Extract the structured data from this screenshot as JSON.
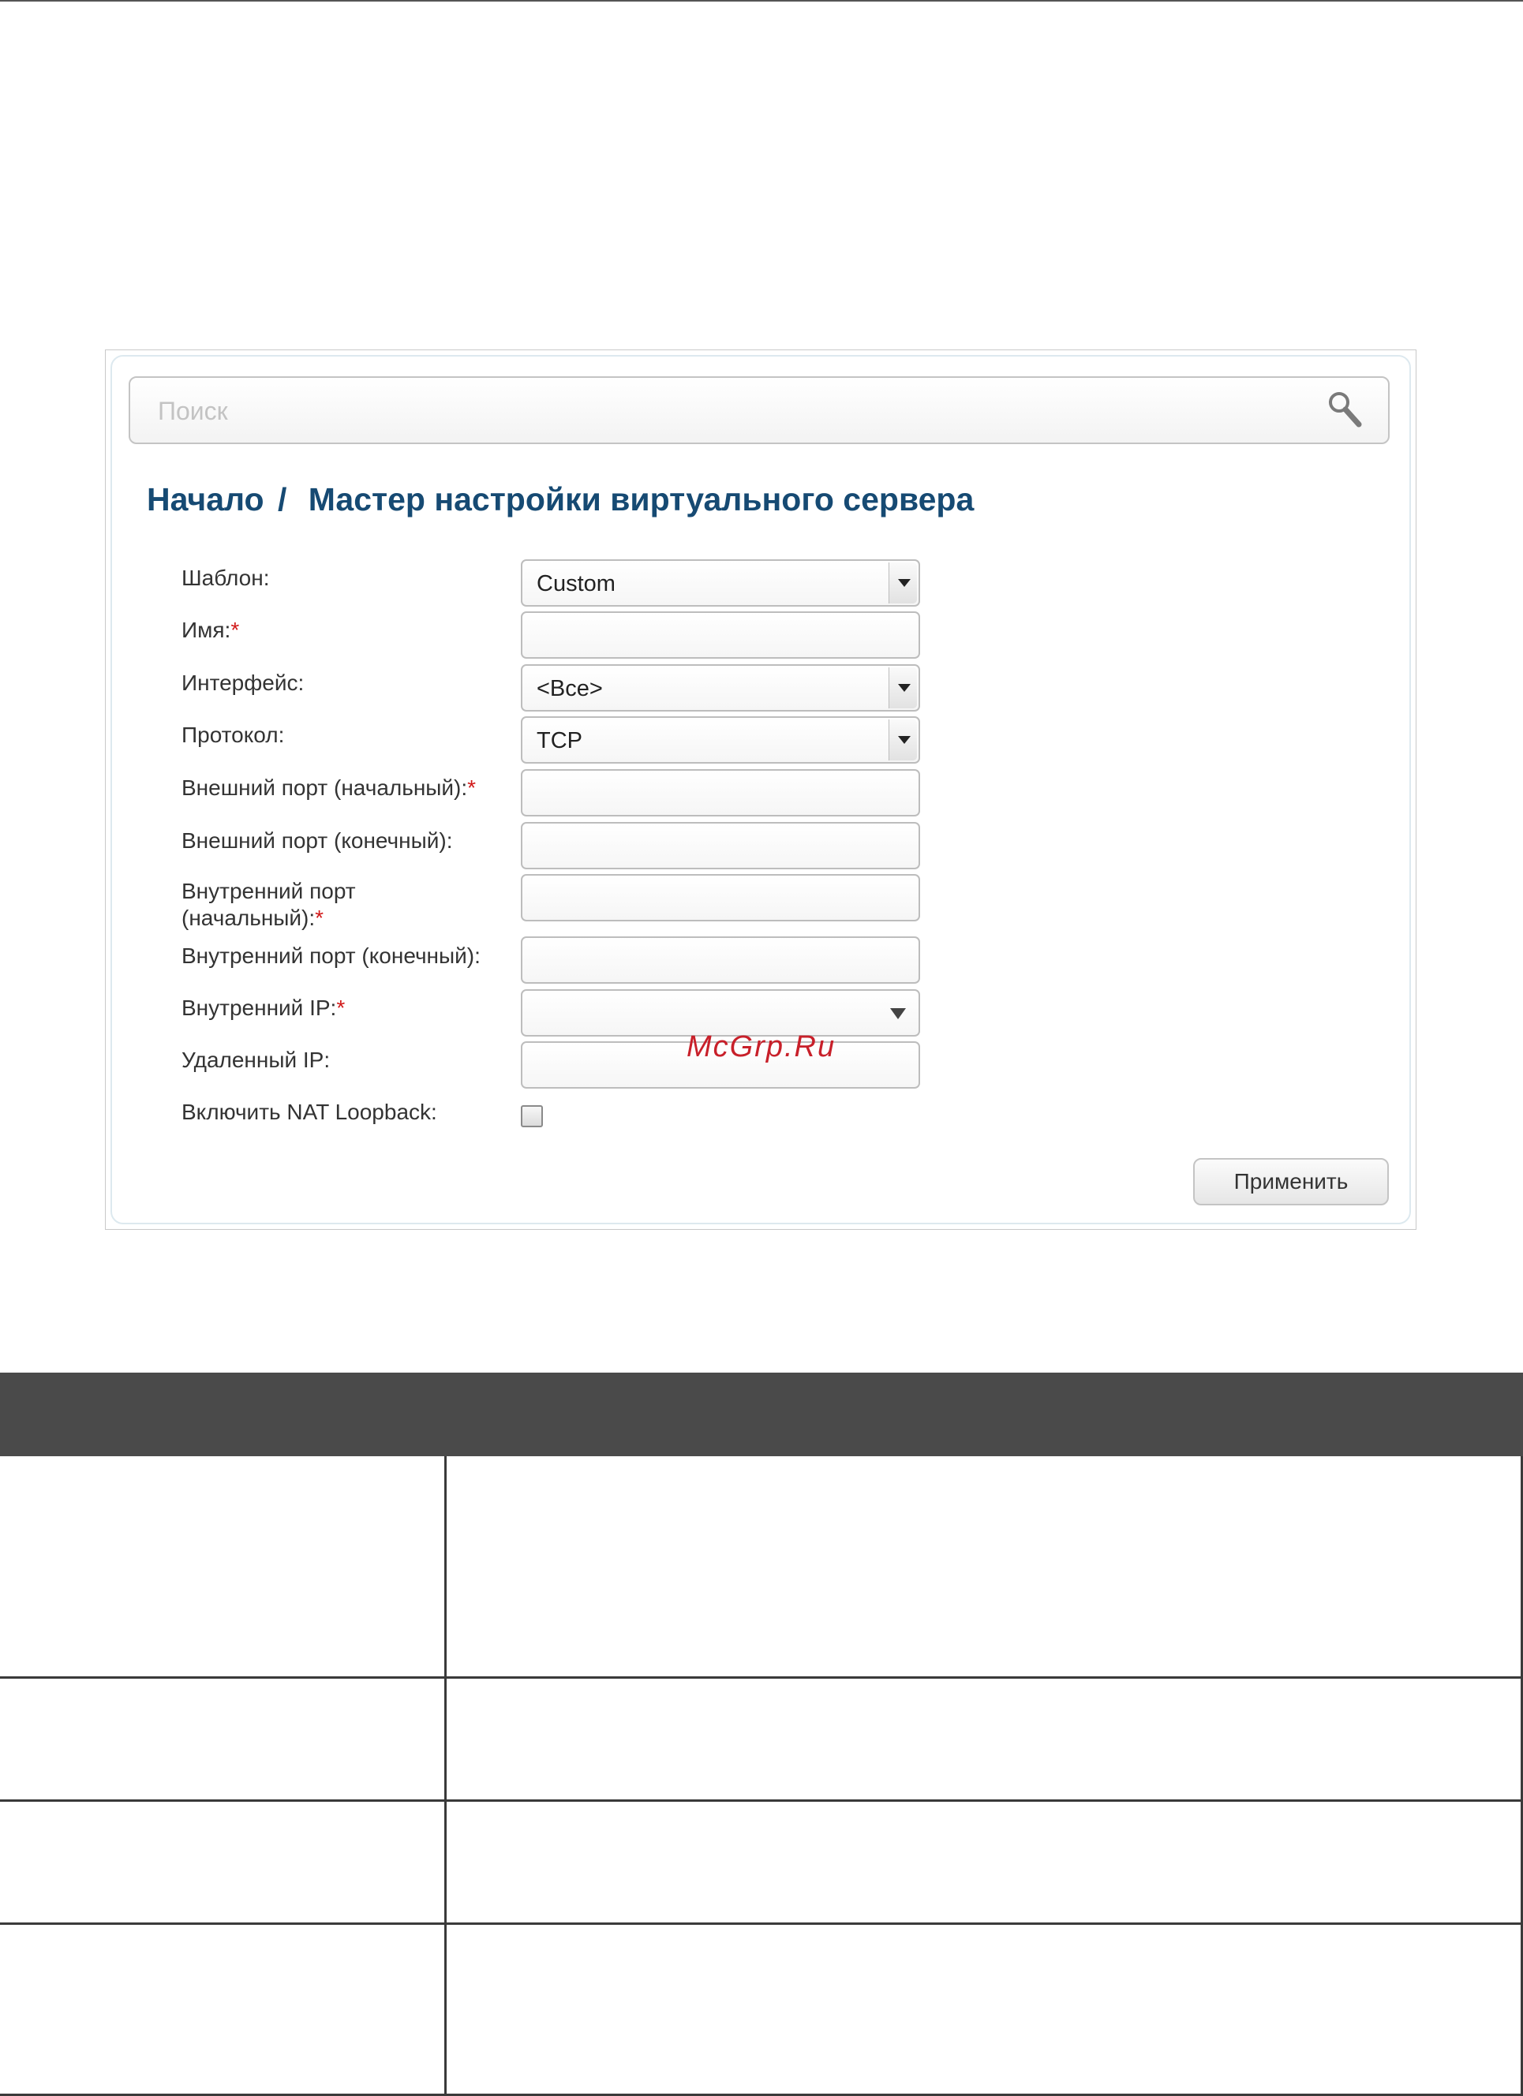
{
  "search": {
    "placeholder": "Поиск"
  },
  "breadcrumb": {
    "home": "Начало",
    "separator": "/",
    "current": "Мастер настройки виртуального сервера"
  },
  "form": {
    "template": {
      "label": "Шаблон:",
      "value": "Custom"
    },
    "name": {
      "label": "Имя:",
      "required": "*",
      "value": ""
    },
    "interface": {
      "label": "Интерфейс:",
      "value": "<Все>"
    },
    "protocol": {
      "label": "Протокол:",
      "value": "TCP"
    },
    "ext_port_start": {
      "label": "Внешний порт (начальный):",
      "required": "*",
      "value": ""
    },
    "ext_port_end": {
      "label": "Внешний порт (конечный):",
      "value": ""
    },
    "int_port_start": {
      "label_line1": "Внутренний порт",
      "label_line2": "(начальный):",
      "required": "*",
      "value": ""
    },
    "int_port_end": {
      "label": "Внутренний порт (конечный):",
      "value": ""
    },
    "internal_ip": {
      "label": "Внутренний IP:",
      "required": "*",
      "value": ""
    },
    "remote_ip": {
      "label": "Удаленный IP:",
      "value": ""
    },
    "nat_loopback": {
      "label": "Включить NAT Loopback:",
      "checked": false
    }
  },
  "apply_label": "Применить",
  "watermark": "McGrp.Ru",
  "colors": {
    "breadcrumb": "#164a73",
    "required": "#d11a1a",
    "table_header": "#4a4a4a",
    "watermark": "#c8202a"
  }
}
